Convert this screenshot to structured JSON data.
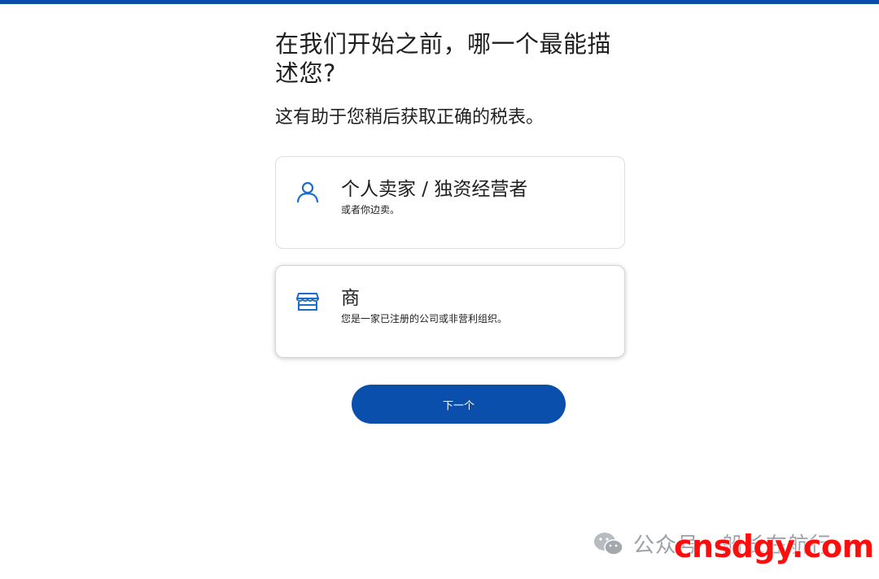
{
  "heading": "在我们开始之前，哪一个最能描述您?",
  "subheading": "这有助于您稍后获取正确的税表。",
  "options": [
    {
      "title": "个人卖家 / 独资经营者",
      "description": "或者你边卖。",
      "icon": "person-icon"
    },
    {
      "title": "商",
      "description": "您是一家已注册的公司或非营利组织。",
      "icon": "storefront-icon"
    }
  ],
  "next_button": "下一个",
  "watermark": {
    "text": "公众号 · 船长在航行",
    "brand": "cnsdgy.com"
  },
  "colors": {
    "primary": "#0b4fad",
    "icon": "#1a6ec7",
    "brand": "#ff0d0d"
  }
}
